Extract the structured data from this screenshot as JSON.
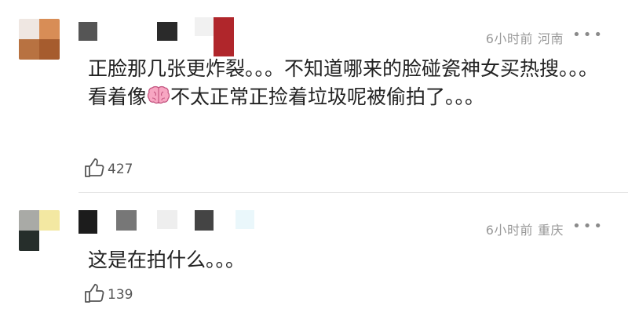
{
  "comments": [
    {
      "meta": {
        "time": "6小时前",
        "location": "河南"
      },
      "more_label": "•••",
      "text_parts": [
        "正脸那几张更炸裂。。。不知道哪来的脸碰瓷神女买热搜。。。看着像",
        "不太正常正捡着垃圾呢被偷拍了。。。"
      ],
      "emoji": "brain-emoji",
      "likes": "427",
      "avatar_colors": [
        "#efe7e2",
        "#d88d56",
        "#b87241",
        "#a65c2e"
      ],
      "name_colors": [
        "#555555",
        "#ffffff",
        "#2a2a2a",
        "#f1f1f1",
        "#b0262b"
      ]
    },
    {
      "meta": {
        "time": "6小时前",
        "location": "重庆"
      },
      "more_label": "•••",
      "text": "这是在拍什么。。。",
      "likes": "139",
      "avatar_colors": [
        "#a9aaa6",
        "#f3e8a2",
        "#262e2b",
        "#ffffff"
      ],
      "name_colors": [
        "#1c1c1c",
        "#777777",
        "#eeeeee",
        "#444444",
        "#eaf7fb"
      ]
    }
  ],
  "icons": {
    "like": "thumbs-up-icon",
    "more": "more-dots-icon"
  }
}
